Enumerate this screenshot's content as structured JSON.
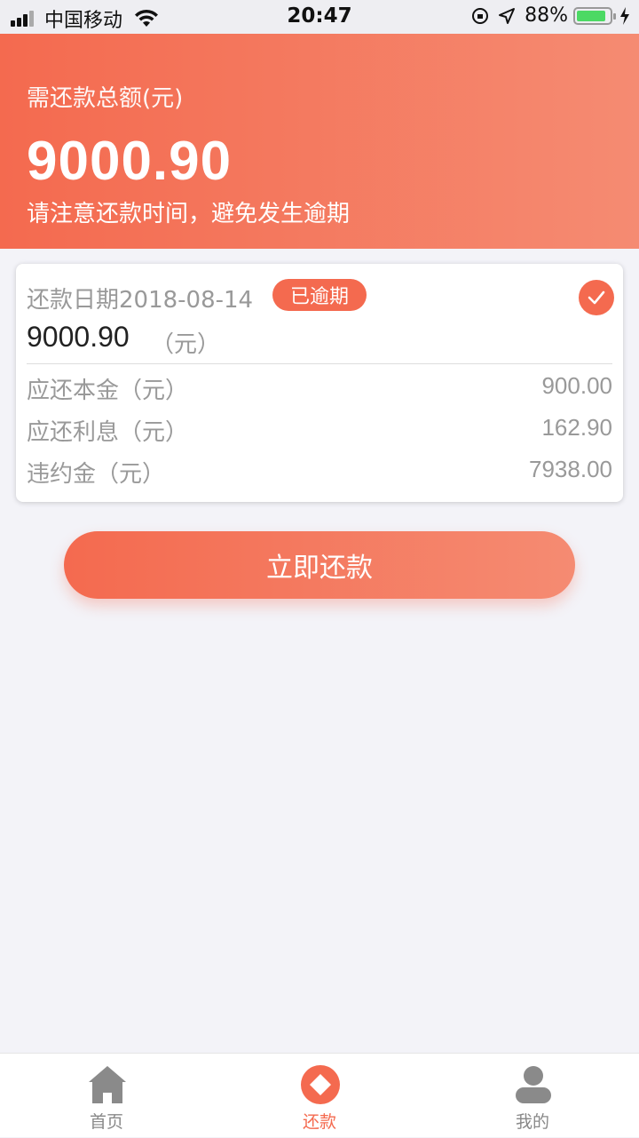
{
  "status_bar": {
    "carrier": "中国移动",
    "time": "20:47",
    "battery": "88%",
    "battery_level": 0.88
  },
  "header": {
    "label": "需还款总额(元)",
    "amount": "9000.90",
    "tip": "请注意还款时间，避免发生逾期"
  },
  "card": {
    "date": "还款日期2018-08-14",
    "badge": "已逾期",
    "total": "9000.90",
    "total_unit": "（元）",
    "rows": [
      {
        "label": "应还本金（元）",
        "value": "900.00"
      },
      {
        "label": "应还利息（元）",
        "value": "162.90"
      },
      {
        "label": "违约金（元）",
        "value": "7938.00"
      }
    ]
  },
  "pay_button": "立即还款",
  "tabbar": {
    "items": [
      {
        "label": "首页",
        "icon": "home-icon"
      },
      {
        "label": "还款",
        "icon": "repay-icon",
        "active": true
      },
      {
        "label": "我的",
        "icon": "profile-icon"
      }
    ]
  },
  "colors": {
    "accent": "#f46a4f",
    "accent_light": "#f58b72",
    "background": "#f3f3f8"
  }
}
